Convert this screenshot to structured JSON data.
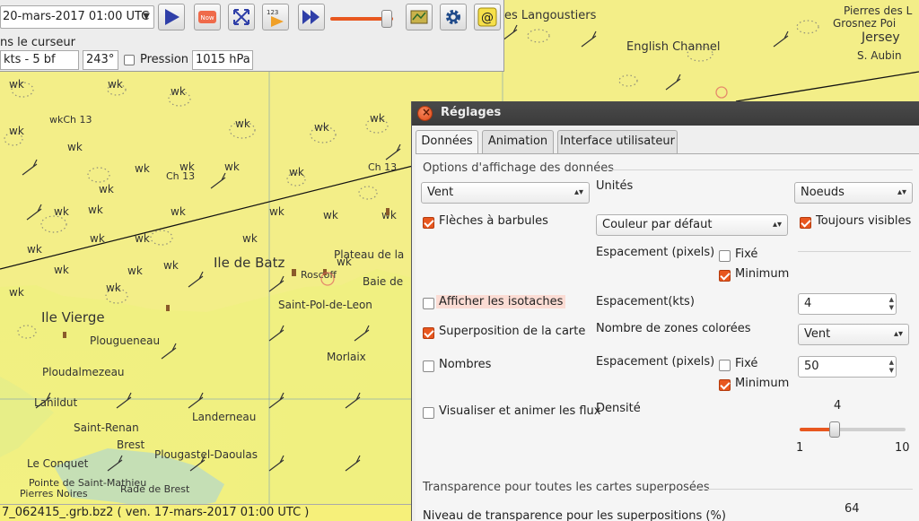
{
  "toolbar": {
    "date_value": "20-mars-2017 01:00  UTC",
    "cursor_label": "ns le curseur",
    "wind_value": "kts -  5 bf",
    "direction_value": "243°",
    "pressure_label": "Pression",
    "pressure_value": "1015 hPa",
    "now_icon_text": "Now",
    "step_icon_text": "123",
    "animation_speed": 0.9
  },
  "map": {
    "places": [
      "English Channel",
      "Pierres des L",
      "Grosnez Poi",
      "Jersey",
      "S. Aubin",
      "Ile de Batz",
      "Ile Vierge",
      "Plougueneau",
      "Morlaix",
      "Landerneau",
      "Saint-Renan",
      "Brest",
      "Plougastel-Daoulas",
      "Ploudalmezeau",
      "Lanildut",
      "Le Conquet",
      "Pointe de Saint-Mathieu",
      "Pierres Noires",
      "Rade de Brest",
      "es Langoustiers",
      "Plateau de la",
      "Baie de",
      "Saint-Pol-de-Leon",
      "Roscoff"
    ],
    "buoy_label": "wk",
    "sea_marks": [
      "Ch 13",
      "Ch 13",
      "wkCh 13"
    ],
    "colors": {
      "land_yellow": "#f3ee88",
      "sea_green": "#9fdcaa"
    }
  },
  "dialog": {
    "title": "Réglages",
    "tabs": [
      "Données",
      "Animation",
      "Interface utilisateur"
    ],
    "active_tab": 0,
    "group_display": "Options d'affichage des données",
    "data_combo": "Vent",
    "units_label": "Unités",
    "units_combo": "Noeuds",
    "barbs_label": "Flèches à barbules",
    "barbs_checked": true,
    "color_combo": "Couleur par défaut",
    "always_visible_label": "Toujours visibles",
    "always_visible_checked": true,
    "spacing_px_label_1": "Espacement (pixels)",
    "fixed_label_1": "Fixé",
    "fixed_checked_1": false,
    "minimum_label_1": "Minimum",
    "minimum_checked_1": true,
    "isotach_label": "Afficher les isotaches",
    "isotach_checked": false,
    "spacing_kts_label": "Espacement(kts)",
    "spacing_kts_value": "4",
    "overlay_label": "Superposition de la carte",
    "overlay_checked": true,
    "color_zones_label": "Nombre de zones colorées",
    "color_zones_combo": "Vent",
    "numbers_label": "Nombres",
    "numbers_checked": false,
    "spacing_px_label_2": "Espacement (pixels)",
    "fixed_label_2": "Fixé",
    "fixed_checked_2": false,
    "spacing_px_value": "50",
    "minimum_label_2": "Minimum",
    "minimum_checked_2": true,
    "flux_label": "Visualiser et animer les flux",
    "flux_checked": false,
    "density_label": "Densité",
    "density_value": "4",
    "density_min": "1",
    "density_max": "10",
    "group_transparency": "Transparence pour toutes les cartes superposées",
    "transparency_label": "Niveau de transparence pour les superpositions (%)",
    "transparency_value": "64"
  },
  "statusbar": {
    "text": "7_062415_.grb.bz2 ( ven. 17-mars-2017 01:00  UTC )"
  }
}
